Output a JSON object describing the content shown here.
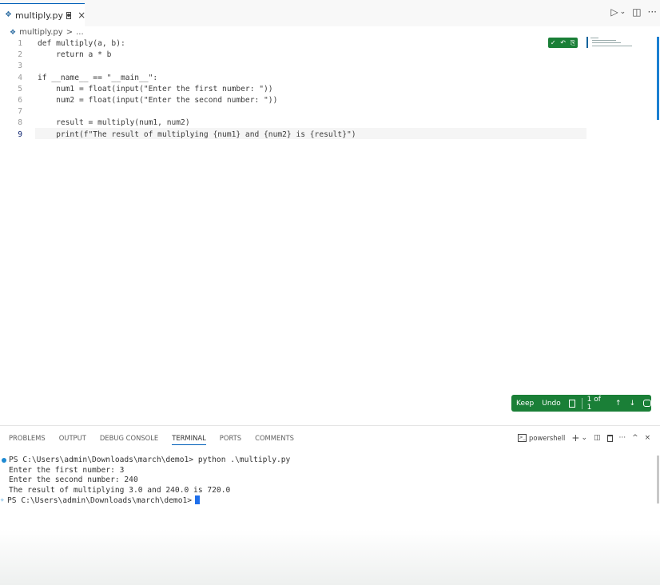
{
  "tab": {
    "filename": "multiply.py",
    "close": "×"
  },
  "tab_actions": {
    "run": "▷",
    "dropdown": "⌄",
    "split": "◫",
    "more": "···"
  },
  "breadcrumb": {
    "file": "multiply.py",
    "sep": ">",
    "more": "..."
  },
  "editor": {
    "active_line": 9,
    "lines": [
      {
        "num": "1",
        "code": "def multiply(a, b):"
      },
      {
        "num": "2",
        "code": "    return a * b"
      },
      {
        "num": "3",
        "code": ""
      },
      {
        "num": "4",
        "code": "if __name__ == \"__main__\":"
      },
      {
        "num": "5",
        "code": "    num1 = float(input(\"Enter the first number: \"))"
      },
      {
        "num": "6",
        "code": "    num2 = float(input(\"Enter the second number: \"))"
      },
      {
        "num": "7",
        "code": ""
      },
      {
        "num": "8",
        "code": "    result = multiply(num1, num2)"
      },
      {
        "num": "9",
        "code": "    print(f\"The result of multiplying {num1} and {num2} is {result}\")"
      }
    ]
  },
  "inline_accept": {
    "check": "✓",
    "undo": "↶",
    "copy": "⎘"
  },
  "keep_bar": {
    "keep": "Keep",
    "undo": "Undo",
    "counter": "1 of 1",
    "up": "↑",
    "down": "↓"
  },
  "panel": {
    "tabs": [
      "PROBLEMS",
      "OUTPUT",
      "DEBUG CONSOLE",
      "TERMINAL",
      "PORTS",
      "COMMENTS"
    ],
    "active_tab": "TERMINAL",
    "shell_name": "powershell",
    "actions": {
      "add": "+",
      "dropdown": "⌄",
      "split": "◫",
      "trash": "🗑",
      "more": "···",
      "maximize": "^",
      "close": "×"
    }
  },
  "terminal": {
    "lines": [
      "PS C:\\Users\\admin\\Downloads\\march\\demo1> python .\\multiply.py",
      "Enter the first number: 3",
      "Enter the second number: 240",
      "The result of multiplying 3.0 and 240.0 is 720.0",
      "PS C:\\Users\\admin\\Downloads\\march\\demo1>"
    ]
  },
  "colors": {
    "accent": "#005fb8",
    "keep_green": "#1a7f37",
    "terminal_blue": "#1f8ad2"
  }
}
